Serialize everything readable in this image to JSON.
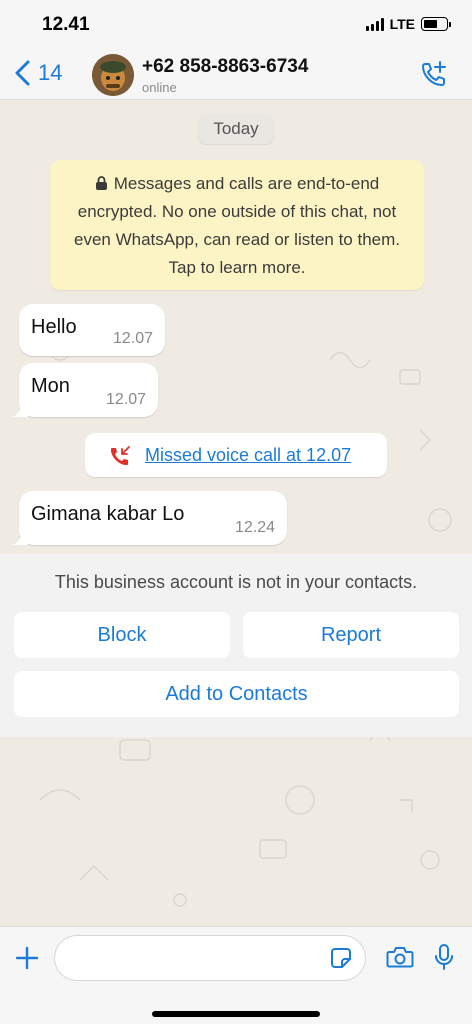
{
  "status_bar": {
    "time": "12.41",
    "network": "LTE",
    "battery_level": 0.6
  },
  "header": {
    "back_count": "14",
    "contact_name": "+62 858-8863-6734",
    "contact_status": "online"
  },
  "chat": {
    "date_label": "Today",
    "encryption_notice": "Messages and calls are end-to-end encrypted. No one outside of this chat, not even WhatsApp, can read or listen to them. Tap to learn more.",
    "messages": [
      {
        "text": "Hello",
        "time": "12.07"
      },
      {
        "text": "Mon",
        "time": "12.07"
      },
      {
        "text": "Gimana kabar Lo",
        "time": "12.24"
      }
    ],
    "missed_call": "Missed voice call at 12.07"
  },
  "business_panel": {
    "notice": "This business account is not in your contacts.",
    "block_label": "Block",
    "report_label": "Report",
    "add_label": "Add to Contacts"
  },
  "composer": {
    "input_value": ""
  },
  "colors": {
    "accent": "#1c7bd6",
    "chat_background": "#efeae2",
    "encryption_background": "#fdf4c5",
    "missed_call_icon": "#e0302a"
  },
  "icons": {
    "back": "chevron-left-icon",
    "call_add": "phone-plus-icon",
    "lock": "lock-icon",
    "missed_call": "missed-call-icon",
    "plus": "plus-icon",
    "sticker": "sticker-icon",
    "camera": "camera-icon",
    "mic": "microphone-icon"
  }
}
